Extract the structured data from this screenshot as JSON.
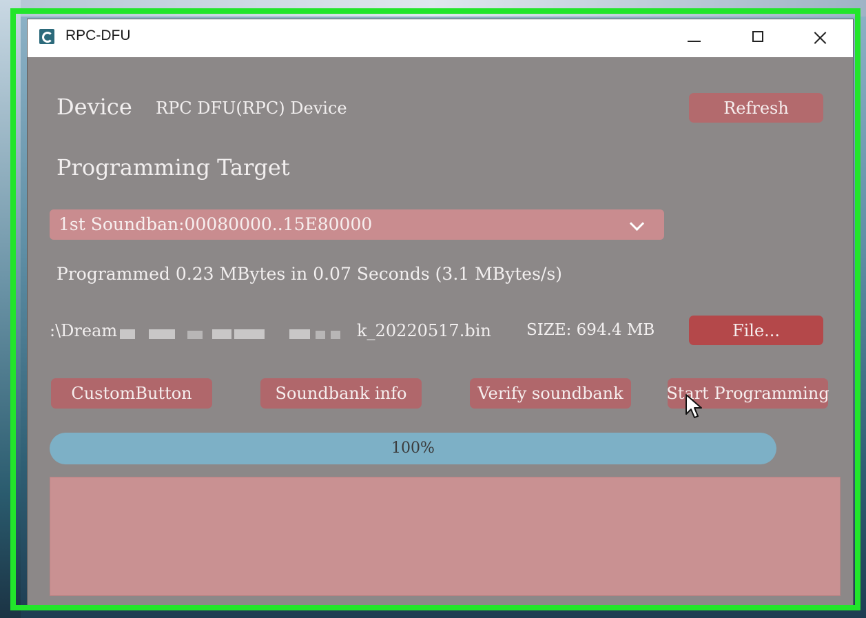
{
  "window": {
    "title": "RPC-DFU",
    "controls": [
      "minimize",
      "maximize",
      "close"
    ]
  },
  "device": {
    "label": "Device",
    "value": "RPC DFU(RPC) Device",
    "refresh_label": "Refresh"
  },
  "target": {
    "label": "Programming Target",
    "selected": "1st Soundban:00080000..15E80000"
  },
  "status": {
    "message": "Programmed 0.23 MBytes in 0.07 Seconds (3.1 MBytes/s)"
  },
  "file": {
    "path_start": ":\\Dream",
    "path_end": "k_20220517.bin",
    "size": "SIZE: 694.4 MB",
    "button_label": "File..."
  },
  "actions": {
    "custom_label": "CustomButton",
    "soundbank_info_label": "Soundbank info",
    "verify_label": "Verify soundbank",
    "start_label": "Start Programming"
  },
  "progress": {
    "value": 1.0,
    "text": "100%"
  },
  "colors": {
    "window_bg": "#8c8888",
    "button": "#b0676b",
    "file_button": "#b4484a",
    "dropdown": "#c98c8f",
    "progress_fill": "#7db0c6",
    "log_area": "#c99192",
    "highlight_border": "#22e52b"
  },
  "icons": {
    "app": "app-icon",
    "dropdown": "chevron-down-icon",
    "pointer": "mouse-cursor-icon"
  }
}
